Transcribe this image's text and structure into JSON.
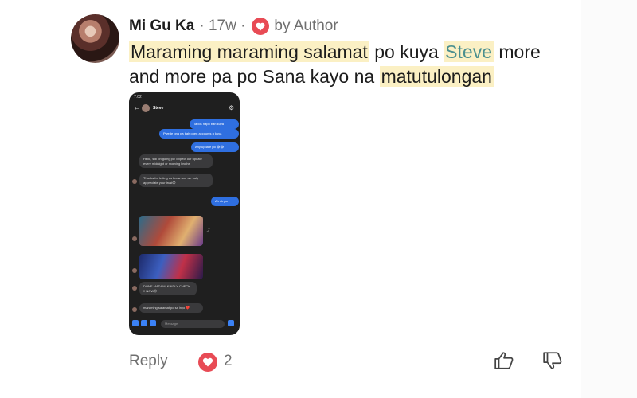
{
  "comment": {
    "author": "Mi Gu Ka",
    "time_meta": "· 17w ·",
    "by_author": "by Author",
    "text_segments": [
      {
        "text": "Maraming maraming salamat",
        "highlight": true
      },
      {
        "text": " po kuya ",
        "highlight": false
      },
      {
        "text": "Steve",
        "highlight": true
      },
      {
        "text": " more and more pa po Sana kayo na ",
        "highlight": false
      },
      {
        "text": "matutulongan",
        "highlight": true
      }
    ]
  },
  "phone": {
    "status": "7:02",
    "title": "Steve",
    "messages": {
      "m1": "Tapos napo bah kuya",
      "m2": "Pwede qna pa bah ooen accounts q kuya",
      "m3": "Any update po 😂😂",
      "m4": "Hello, still on going po! Expect our update every midnight or morning brothe",
      "m5": "Thanks for letting us know and we truly appreciate your trust😉",
      "m6": "Ah ok po",
      "m7": "DONE MADAM, KINDLY CHECK !! NOW😊",
      "m8": "maraming salamat po sa inyo ❤️"
    },
    "input_placeholder": "Message"
  },
  "footer": {
    "reply_label": "Reply",
    "reaction_count": "2"
  },
  "colors": {
    "highlight": "#fbf0c4",
    "heart": "#e84b55",
    "steve_text": "#4a8f8f"
  }
}
